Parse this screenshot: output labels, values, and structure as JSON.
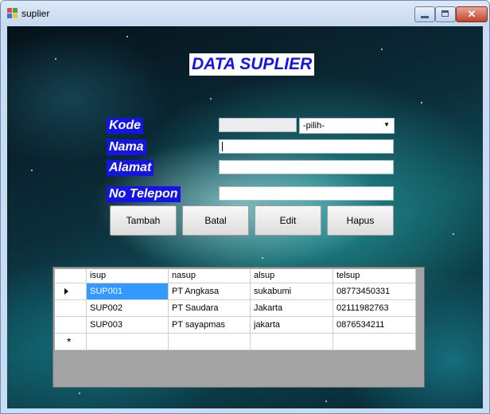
{
  "window": {
    "title": "suplier"
  },
  "form": {
    "heading": "DATA SUPLIER",
    "labels": {
      "kode": "Kode",
      "nama": "Nama",
      "alamat": "Alamat",
      "telepon": "No Telepon"
    },
    "values": {
      "kode": "",
      "nama": "",
      "alamat": "",
      "telepon": ""
    },
    "dropdown": {
      "selected": "-pilih-"
    }
  },
  "buttons": {
    "tambah": "Tambah",
    "batal": "Batal",
    "edit": "Edit",
    "hapus": "Hapus"
  },
  "grid": {
    "columns": [
      "isup",
      "nasup",
      "alsup",
      "telsup"
    ],
    "rows": [
      [
        "SUP001",
        "PT Angkasa",
        "sukabumi",
        "08773450331"
      ],
      [
        "SUP002",
        "PT Saudara",
        "Jakarta",
        "02111982763"
      ],
      [
        "SUP003",
        "PT sayapmas",
        "jakarta",
        "0876534211"
      ]
    ],
    "new_row_marker": "*"
  },
  "colors": {
    "label_bg": "#1414e6",
    "selection": "#3399ff"
  }
}
